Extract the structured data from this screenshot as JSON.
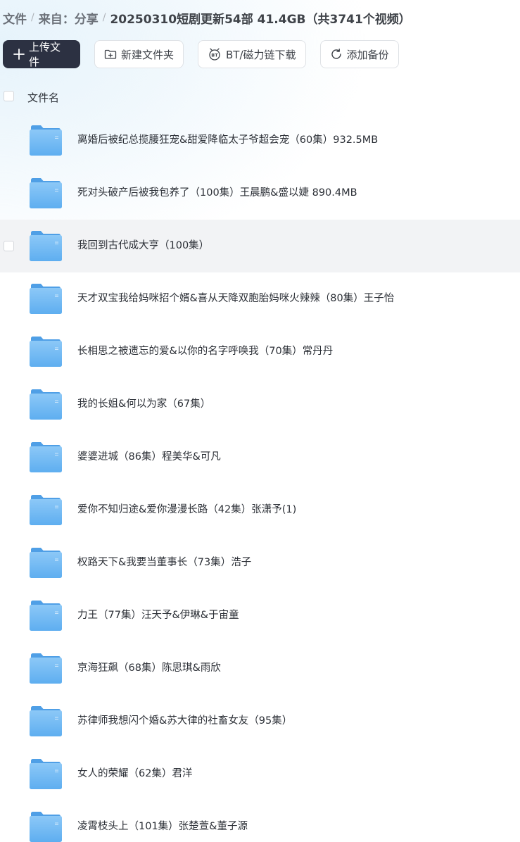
{
  "breadcrumb": {
    "root": "文件",
    "from": "来自：分享",
    "current": "20250310短剧更新54部 41.4GB（共3741个视频）"
  },
  "toolbar": {
    "upload_label": "上传文件",
    "new_folder_label": "新建文件夹",
    "bt_label": "BT/磁力链下载",
    "backup_label": "添加备份"
  },
  "list_header": {
    "name_label": "文件名"
  },
  "files": [
    {
      "name": "离婚后被纪总揽腰狂宠&甜爱降临太子爷超会宠（60集）932.5MB"
    },
    {
      "name": "死对头破产后被我包养了（100集）王晨鹏&盛以婕 890.4MB"
    },
    {
      "name": "我回到古代成大亨（100集）"
    },
    {
      "name": "天才双宝我给妈咪招个婿&喜从天降双胞胎妈咪火辣辣（80集）王子怡"
    },
    {
      "name": "长相思之被遗忘的爱&以你的名字呼唤我（70集）常丹丹"
    },
    {
      "name": "我的长姐&何以为家（67集）"
    },
    {
      "name": "婆婆进城（86集）程美华&可凡"
    },
    {
      "name": "爱你不知归途&爱你漫漫长路（42集）张潇予(1)"
    },
    {
      "name": "权路天下&我要当董事长（73集）浩子"
    },
    {
      "name": "力王（77集）汪天予&伊琳&于宙童"
    },
    {
      "name": "京海狂飙（68集）陈思琪&雨欣"
    },
    {
      "name": "苏律师我想闪个婚&苏大律的社畜女友（95集）"
    },
    {
      "name": "女人的荣耀（62集）君洋"
    },
    {
      "name": "凌霄枝头上（101集）张楚萱&董子源"
    }
  ]
}
